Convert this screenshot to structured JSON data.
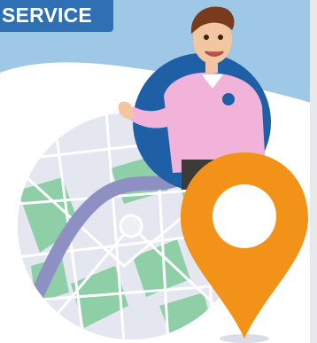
{
  "header": {
    "service_label": "SERVICE"
  },
  "colors": {
    "sky_blue": "#9fc7e6",
    "tab_blue": "#2f6fb3",
    "circle_blue": "#1f5fa6",
    "map_green": "#8fcfa8",
    "route_purple": "#8e8fc3",
    "pin_orange": "#f39219",
    "shirt_pink": "#f1b3d9"
  },
  "illustration": {
    "subject": "person-pointing-at-map-pin",
    "icons": [
      "map-pin-icon",
      "route-icon",
      "logo-badge-icon"
    ]
  }
}
